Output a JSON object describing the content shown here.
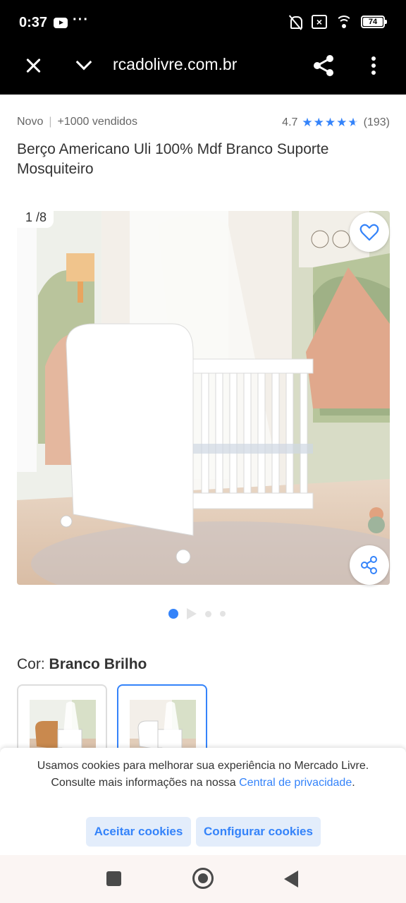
{
  "status_bar": {
    "time": "0:37",
    "battery": "74"
  },
  "browser": {
    "url": "rcadolivre.com.br"
  },
  "product": {
    "condition": "Novo",
    "sold": "+1000 vendidos",
    "rating": "4.7",
    "stars_value": 4.7,
    "reviews": "(193)",
    "title": "Berço Americano Uli 100% Mdf Branco Suporte Mosquiteiro"
  },
  "gallery": {
    "counter": "1 /8",
    "current_index": 1,
    "total": 8
  },
  "variation": {
    "label": "Cor:",
    "value": "Branco Brilho"
  },
  "cookie_banner": {
    "text": "Usamos cookies para melhorar sua experiência no Mercado Livre. Consulte mais informações na nossa",
    "link": "Central de privacidade",
    "link_suffix": ".",
    "accept_label": "Aceitar cookies",
    "configure_label": "Configurar cookies"
  },
  "colors": {
    "accent": "#3483fa",
    "button_bg": "#e3edfb"
  },
  "icons": [
    "close-icon",
    "chevron-down-icon",
    "share-icon",
    "more-vertical-icon",
    "heart-icon",
    "share-icon",
    "stop-icon",
    "home-icon",
    "back-icon"
  ]
}
